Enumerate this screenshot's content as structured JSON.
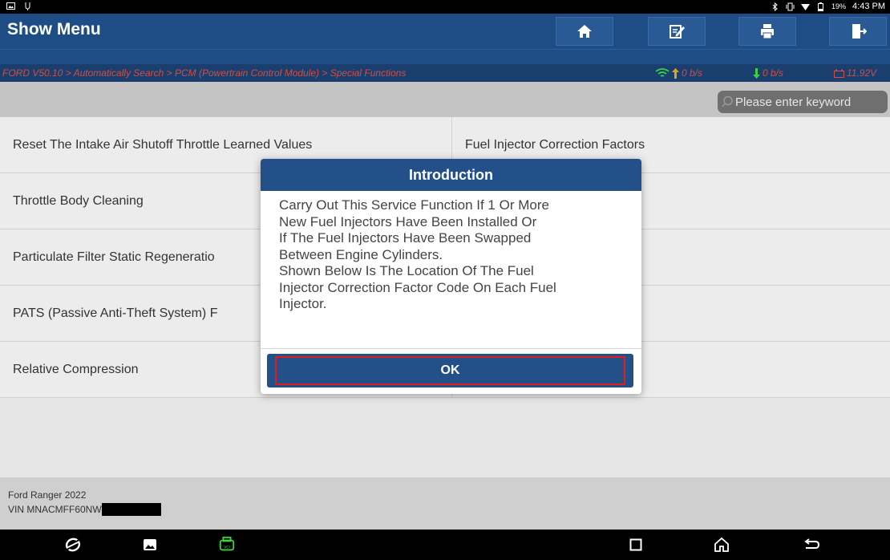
{
  "status_bar": {
    "battery": "19%",
    "time": "4:43 PM"
  },
  "header": {
    "title": "Show Menu",
    "buttons": [
      {
        "icon": "home-icon"
      },
      {
        "icon": "edit-icon"
      },
      {
        "icon": "print-icon"
      },
      {
        "icon": "exit-icon"
      }
    ]
  },
  "breadcrumb": "FORD V50.10 > Automatically Search > PCM (Powertrain Control Module) > Special Functions",
  "stats": {
    "upload": "0 b/s",
    "download": "0 b/s",
    "voltage": "11.92V"
  },
  "search": {
    "placeholder": "Please enter keyword"
  },
  "menu_items": [
    {
      "label": "Reset The Intake Air Shutoff Throttle Learned Values"
    },
    {
      "label": "Fuel Injector Correction Factors"
    },
    {
      "label": "Throttle Body Cleaning"
    },
    {
      "label": ""
    },
    {
      "label": "Particulate Filter Static Regeneratio"
    },
    {
      "label": ""
    },
    {
      "label": "PATS (Passive Anti-Theft System) F"
    },
    {
      "label": ""
    },
    {
      "label": "Relative Compression"
    },
    {
      "label": ""
    }
  ],
  "vehicle": {
    "model": "Ford Ranger 2022",
    "vin": "VIN MNACMFF60NW"
  },
  "dialog": {
    "title": "Introduction",
    "body": "Carry Out This Service Function If 1 Or More\nNew Fuel Injectors Have Been Installed Or\nIf The Fuel Injectors Have Been Swapped\nBetween Engine Cylinders.\nShown Below Is The Location Of The Fuel\nInjector Correction Factor Code On Each Fuel\nInjector.",
    "ok_label": "OK"
  },
  "colors": {
    "header_bg": "#1e4d86",
    "breadcrumb_text": "#d94b3b",
    "highlight_border": "#e21b1b",
    "vci_icon": "#39d53a"
  }
}
